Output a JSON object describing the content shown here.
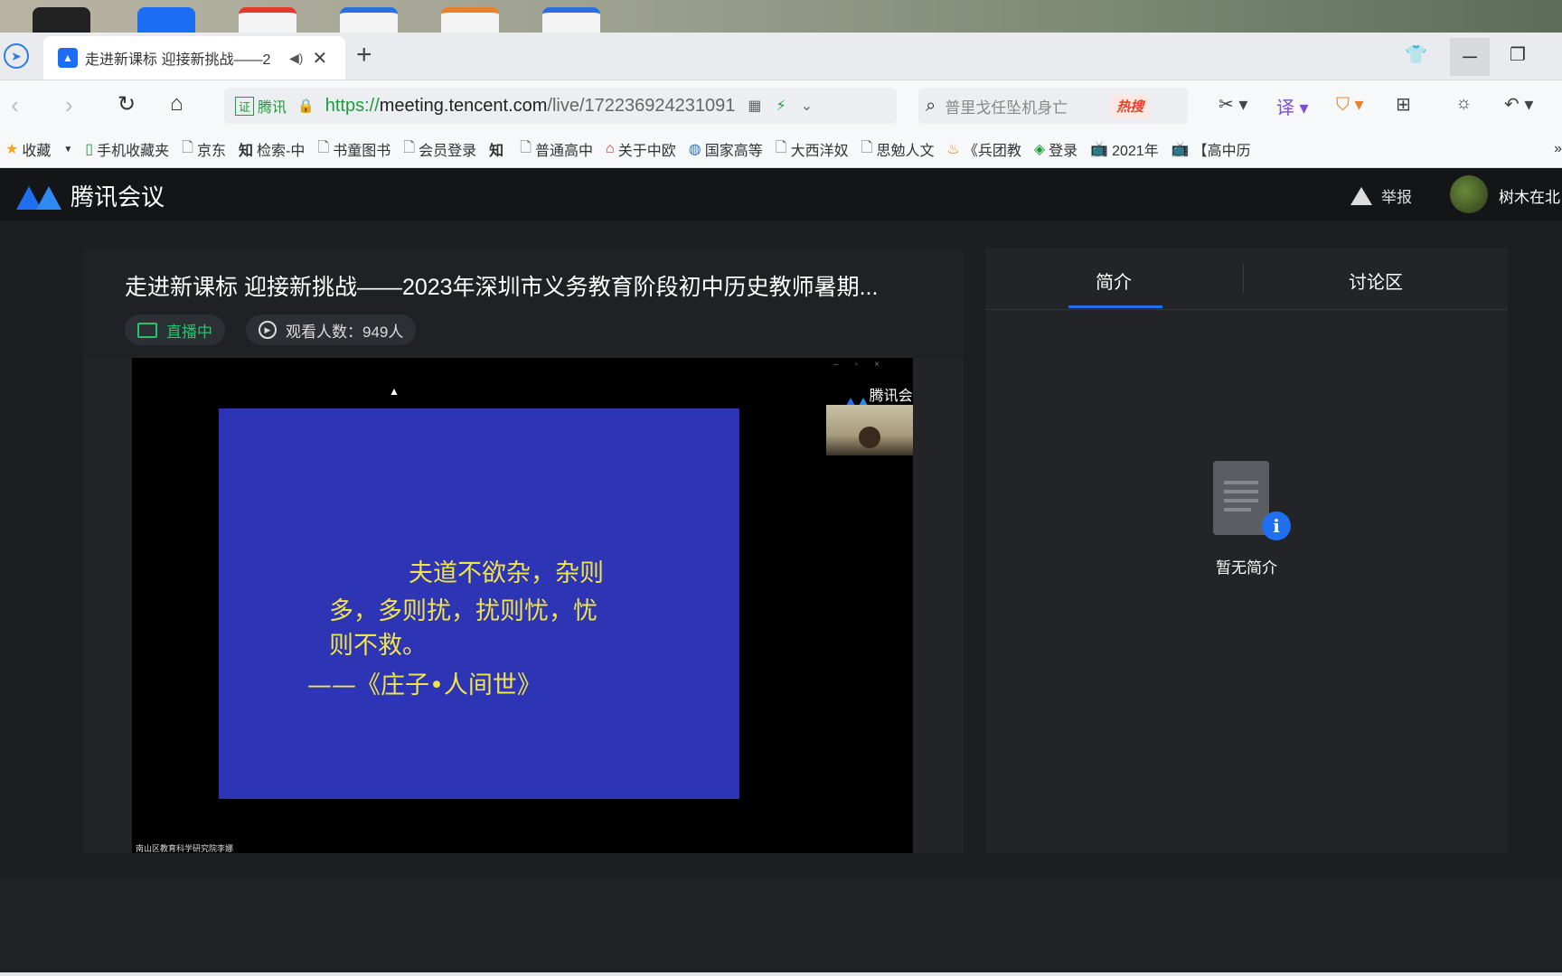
{
  "browser": {
    "tab_title": "走进新课标 迎接新挑战——2",
    "new_tab": "+",
    "cert_label": "证",
    "cert_org": "腾讯",
    "url_prefix": "https://",
    "url_domain": "meeting.tencent.com",
    "url_path": "/live/1722369242310​91",
    "search_placeholder": "普里戈任坠机身亡",
    "hot_search": "热搜"
  },
  "bookmarks": [
    {
      "label": "收藏",
      "icon": "star-icon"
    },
    {
      "label": "手机收藏夹",
      "icon": "phone-icon"
    },
    {
      "label": "京东",
      "icon": "page-icon"
    },
    {
      "label": "检索-中",
      "icon": "zhi-icon"
    },
    {
      "label": "书童图书",
      "icon": "page-icon"
    },
    {
      "label": "会员登录",
      "icon": "page-icon"
    },
    {
      "label": "",
      "icon": "zhi-icon"
    },
    {
      "label": "普通高中",
      "icon": "page-icon"
    },
    {
      "label": "关于中欧",
      "icon": "home-icon"
    },
    {
      "label": "国家高等",
      "icon": "globe-icon"
    },
    {
      "label": "大西洋奴",
      "icon": "page-icon"
    },
    {
      "label": "思勉人文",
      "icon": "page-icon"
    },
    {
      "label": "《兵团教",
      "icon": "flame-icon"
    },
    {
      "label": "登录",
      "icon": "leaf-icon"
    },
    {
      "label": "2021年",
      "icon": "bili-icon"
    },
    {
      "label": "【高中历",
      "icon": "bili-icon"
    }
  ],
  "app": {
    "brand": "腾讯会议",
    "report": "举报",
    "username": "树木在北"
  },
  "video": {
    "title": "走进新课标 迎接新挑战——2023年深圳市义务教育阶段初中历史教师暑期...",
    "live_status": "直播中",
    "viewers": "观看人数：949人",
    "brand_overlay": "腾讯会议",
    "slide_lines": [
      "夫道不欲杂，杂则",
      "多，多则扰，扰则忧，忧",
      "则不救。",
      "——《庄子•人间世》"
    ],
    "watermark": "南山区教育科学研究院李娜"
  },
  "side_panel": {
    "tab_intro": "简介",
    "tab_discussion": "讨论区",
    "empty_text": "暂无简介"
  },
  "colors": {
    "accent": "#1f6ff0",
    "live": "#22c36c",
    "slide_bg": "#2d35b5",
    "slide_text": "#f1e44a"
  }
}
